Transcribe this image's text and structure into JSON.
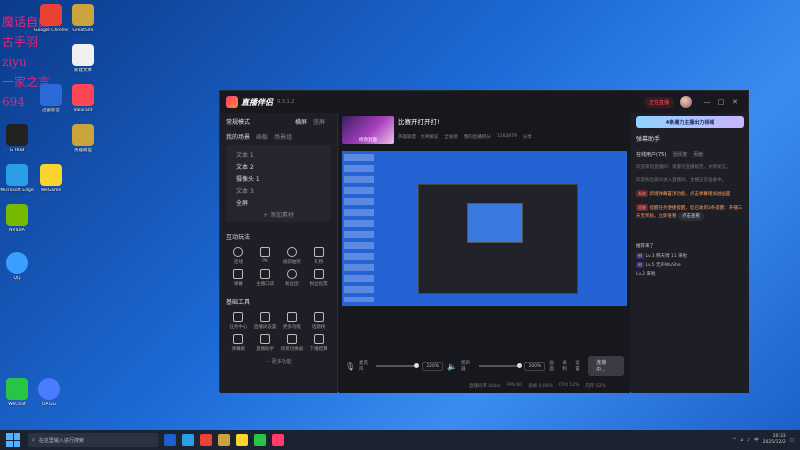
{
  "desktop": {
    "overlay_lines": [
      "魔话自由",
      "古手羽",
      "ziyu",
      "一家之言",
      "694"
    ],
    "icons": [
      {
        "label": "Google Chrome",
        "color": "#e94235"
      },
      {
        "label": "GreatSite",
        "color": "#c9a43c"
      },
      {
        "label": "新建文本",
        "color": "#f0f0f0"
      },
      {
        "label": "英雄联盟",
        "color": "#c9a43c"
      },
      {
        "label": "迅雷影音",
        "color": "#2c6ad8"
      },
      {
        "label": "Valorant",
        "color": "#ff4655"
      },
      {
        "label": "G HUB",
        "color": "#222"
      },
      {
        "label": "Microsoft Edge",
        "color": "#2a9ee8"
      },
      {
        "label": "WeGame",
        "color": "#fbd32f"
      },
      {
        "label": "NVIDIA",
        "color": "#76b900"
      },
      {
        "label": "QQ",
        "color": "#39a0ff"
      },
      {
        "label": "WeChat",
        "color": "#28c445"
      },
      {
        "label": "OP.GG",
        "color": "#4b7bff"
      }
    ]
  },
  "app": {
    "name": "直播伴侣",
    "version": "9.3.1.2",
    "live_badge": "正在直播",
    "window_buttons": [
      "—",
      "□",
      "✕"
    ],
    "left": {
      "scene_mode": "常规模式",
      "mode_tabs": [
        "横屏",
        "竖屏"
      ],
      "my_scenes": "我的场景",
      "scene_tabs": [
        "画板",
        "场景组"
      ],
      "sources": [
        "文本 1",
        "文本 2",
        "摄像头 1",
        "文本 3",
        "全屏"
      ],
      "add_source": "+ 添加素材",
      "interactive_title": "互动玩法",
      "interactive_tools": [
        "连线",
        "PK",
        "福袋抽奖",
        "礼物",
        "弹幕",
        "主播口袋",
        "粉丝团",
        "粉丝投票"
      ],
      "basic_title": "基础工具",
      "basic_tools": [
        "任务中心",
        "直播间设置",
        "更多功能",
        "话题榜",
        "弹幕姬",
        "直播助手",
        "场景切换器",
        "下播结算"
      ],
      "more_label": "··· 更多功能"
    },
    "center": {
      "thumb_label": "修改封面",
      "stream_title": "比赛开打开打!",
      "stream_meta": [
        "英雄联盟 · 大神解说",
        "全站榜",
        "我的直播积分",
        "1162879",
        "分享"
      ],
      "mic_label": "麦克风",
      "mic_pct": "220%",
      "speaker_label": "扬声器",
      "speaker_pct": "200%",
      "extra_ctrls": [
        "画面",
        "录制",
        "设置"
      ],
      "go_live": "连接中...",
      "stats": [
        "直播码率 0kb/s",
        "FPS:60",
        "丢帧 0.00%",
        "CPU 12%",
        "内存 52%"
      ]
    },
    "right": {
      "banner": "4条潮力主播出力领域",
      "assistant_title": "弹幕助手",
      "tabs": [
        "在线用户(75)",
        "活跃度",
        "贡献"
      ],
      "messages": [
        "欢迎来到直播间！请遵守直播规范，文明发言。",
        "欢迎各位观众进入直播间，主播正在准备中。",
        "新增弹幕置顶功能，点击弹幕增加进画面",
        "提醒任务便捷提醒，您已收到3条提醒：开播三天无奖励，立即查看",
        "点击查看"
      ],
      "recommend": "推荐来了",
      "users": [
        "Lv.3 韩天博 11 来啦",
        "Lv.5 无声WuShe",
        "Lv.2 来啦"
      ]
    }
  },
  "taskbar": {
    "search_placeholder": "在这里输入进行搜索",
    "time": "20:33",
    "date": "2025/12/2"
  }
}
